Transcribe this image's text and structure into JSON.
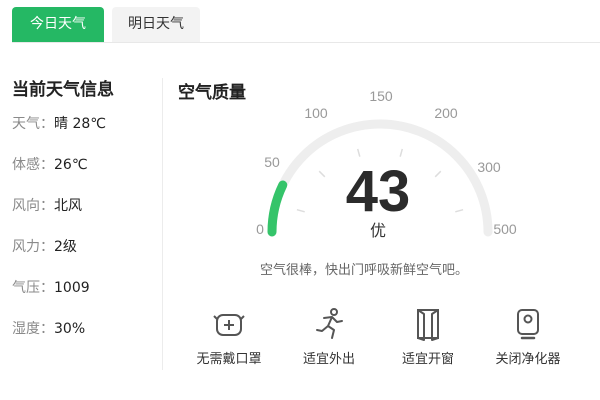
{
  "tabs": [
    {
      "label": "今日天气",
      "active": true
    },
    {
      "label": "明日天气",
      "active": false
    }
  ],
  "current": {
    "title": "当前天气信息",
    "rows": [
      {
        "key": "天气：",
        "value": "晴 28℃"
      },
      {
        "key": "体感：",
        "value": "26℃"
      },
      {
        "key": "风向：",
        "value": "北风"
      },
      {
        "key": "风力：",
        "value": "2级"
      },
      {
        "key": "气压：",
        "value": "1009"
      },
      {
        "key": "湿度：",
        "value": "30%"
      }
    ]
  },
  "air_quality": {
    "title": "空气质量",
    "aqi": "43",
    "level": "优",
    "scale": [
      "0",
      "50",
      "100",
      "150",
      "200",
      "300",
      "500"
    ],
    "tip": "空气很棒，快出门呼吸新鲜空气吧。",
    "accent_color": "#35c46a",
    "track_color": "#eeeeee"
  },
  "advice": [
    {
      "icon": "mask-icon",
      "label": "无需戴口罩"
    },
    {
      "icon": "running-person-icon",
      "label": "适宜外出"
    },
    {
      "icon": "window-icon",
      "label": "适宜开窗"
    },
    {
      "icon": "air-purifier-icon",
      "label": "关闭净化器"
    }
  ]
}
